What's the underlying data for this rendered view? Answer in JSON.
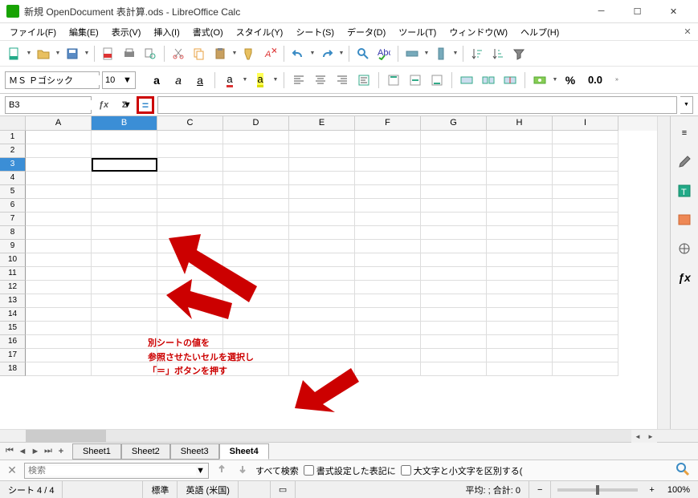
{
  "window": {
    "title": "新規 OpenDocument 表計算.ods - LibreOffice Calc"
  },
  "menu": {
    "file": "ファイル(F)",
    "edit": "編集(E)",
    "view": "表示(V)",
    "insert": "挿入(I)",
    "format": "書式(O)",
    "style": "スタイル(Y)",
    "sheet": "シート(S)",
    "data": "データ(D)",
    "tools": "ツール(T)",
    "window": "ウィンドウ(W)",
    "help": "ヘルプ(H)"
  },
  "font": {
    "name": "ＭＳ Ｐゴシック",
    "size": "10"
  },
  "formula": {
    "cell_ref": "B3",
    "content": ""
  },
  "columns": [
    "A",
    "B",
    "C",
    "D",
    "E",
    "F",
    "G",
    "H",
    "I"
  ],
  "selected_col": "B",
  "selected_row": 3,
  "rows_count": 18,
  "tabs": {
    "items": [
      "Sheet1",
      "Sheet2",
      "Sheet3",
      "Sheet4"
    ],
    "active": "Sheet4"
  },
  "find": {
    "placeholder": "検索",
    "all": "すべて検索",
    "fmt": "書式設定した表記に",
    "case": "大文字と小文字を区別する("
  },
  "status": {
    "sheet": "シート 4 / 4",
    "style": "標準",
    "lang": "英語 (米国)",
    "calc": "平均: ; 合計: 0",
    "zoom": "100%"
  },
  "percent_label": "%",
  "decimal_label": "0.0",
  "annotation": {
    "line1": "別シートの値を",
    "line2": "参照させたいセルを選択し",
    "line3": "「＝」ボタンを押す"
  }
}
